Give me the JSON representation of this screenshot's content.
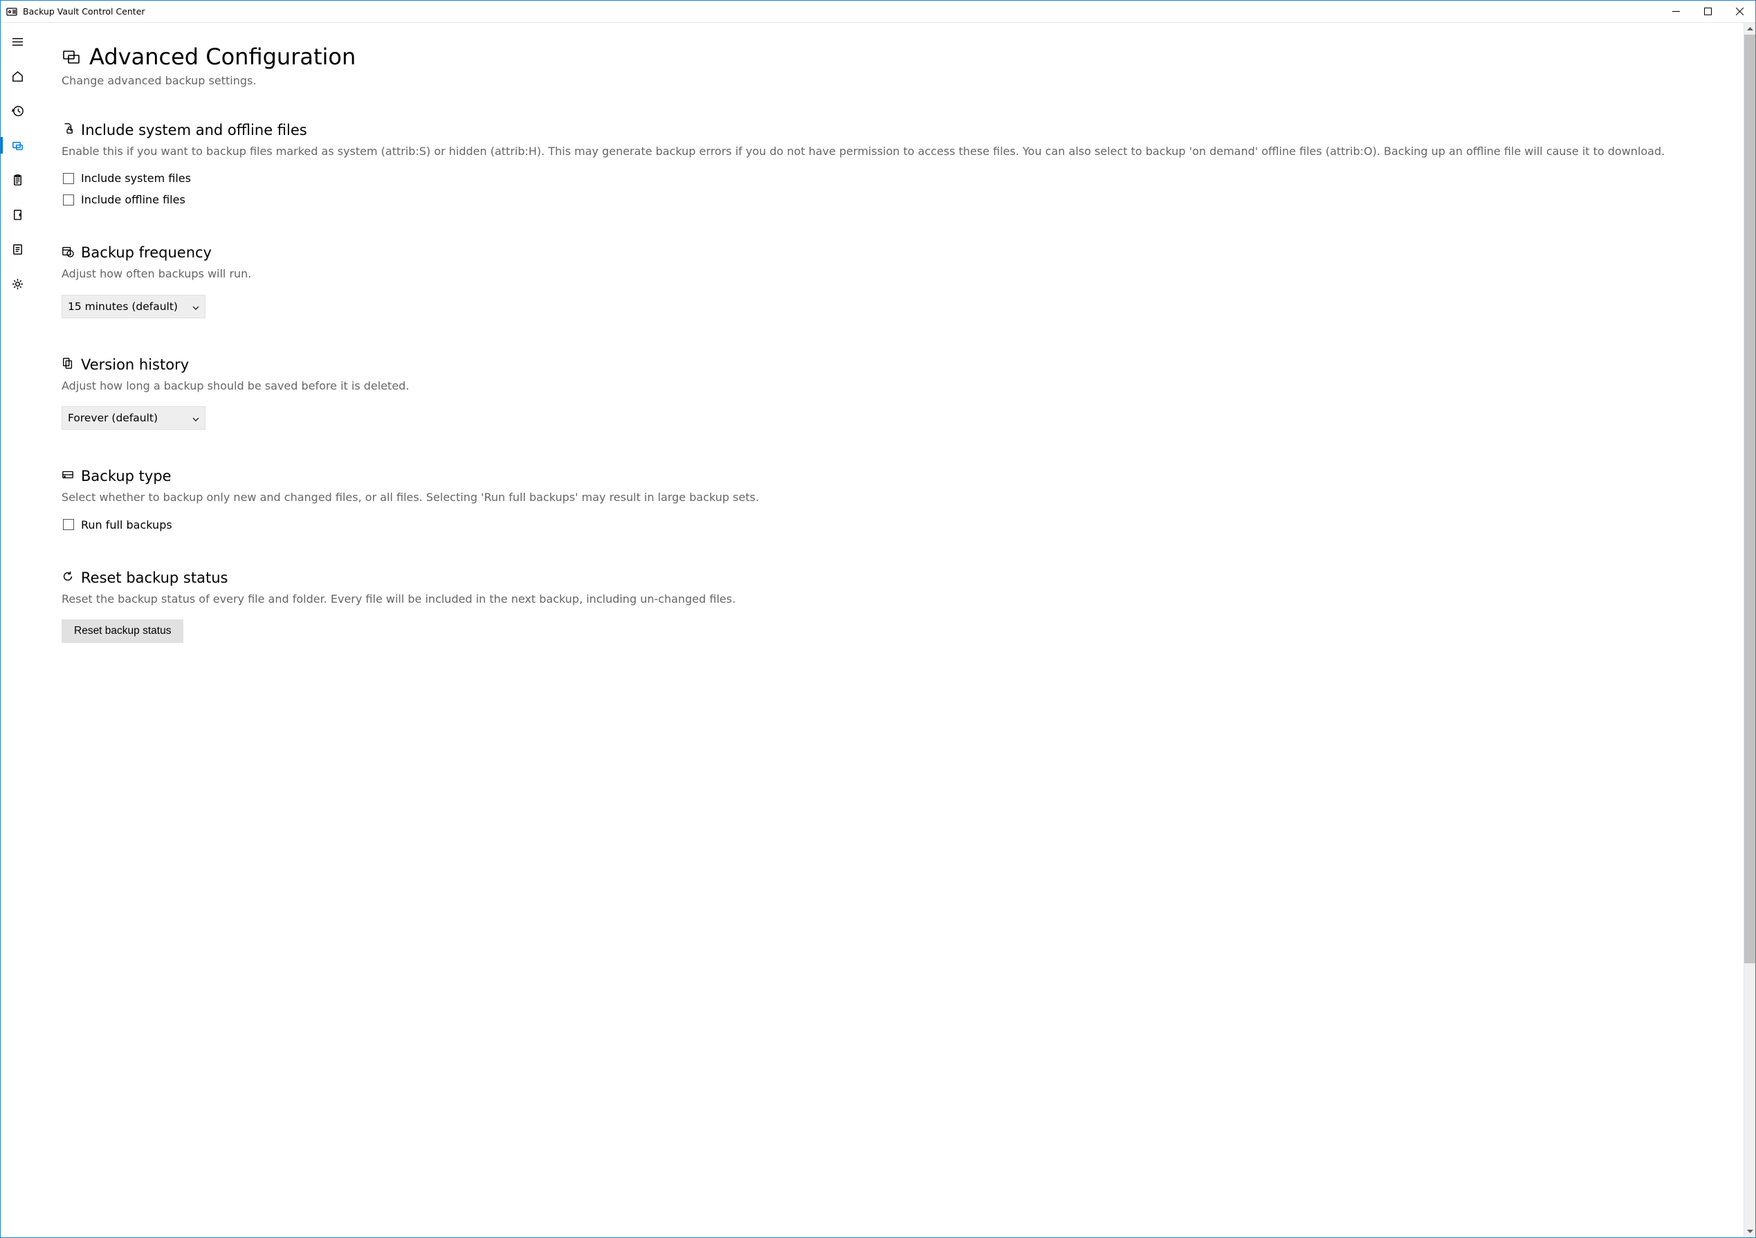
{
  "window": {
    "title": "Backup Vault Control Center"
  },
  "sidebar": {
    "items": [
      {
        "name": "menu"
      },
      {
        "name": "home"
      },
      {
        "name": "history"
      },
      {
        "name": "advanced",
        "selected": true
      },
      {
        "name": "clipboard"
      },
      {
        "name": "export"
      },
      {
        "name": "log"
      },
      {
        "name": "settings"
      }
    ]
  },
  "page": {
    "title": "Advanced Configuration",
    "subtitle": "Change advanced backup settings."
  },
  "sections": {
    "include": {
      "title": "Include system and offline files",
      "desc": "Enable this if you want to backup files marked as system (attrib:S) or hidden (attrib:H). This may generate backup errors if you do not have permission to access these files. You can also select to backup 'on demand' offline files (attrib:O). Backing up an offline file will cause it to download.",
      "cb1": "Include system files",
      "cb2": "Include offline files"
    },
    "frequency": {
      "title": "Backup frequency",
      "desc": "Adjust how often backups will run.",
      "value": "15 minutes (default)"
    },
    "history": {
      "title": "Version history",
      "desc": "Adjust how long a backup should be saved before it is deleted.",
      "value": "Forever (default)"
    },
    "type": {
      "title": "Backup type",
      "desc": "Select whether to backup only new and changed files, or all files. Selecting 'Run full backups' may result in large backup sets.",
      "cb1": "Run full backups"
    },
    "reset": {
      "title": "Reset backup status",
      "desc": "Reset the backup status of every file and folder. Every file will be included in the next backup, including un-changed files.",
      "button": "Reset backup status"
    }
  }
}
